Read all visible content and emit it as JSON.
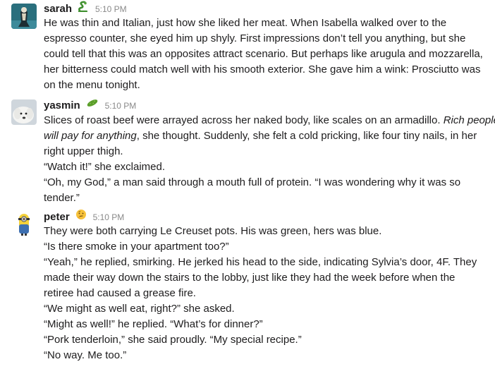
{
  "messages": [
    {
      "sender": "sarah",
      "status_emoji": "snake-emoji-icon",
      "time": "5:10 PM",
      "lines": [
        "He was thin and Italian, just how she liked her meat. When Isabella walked over to the",
        "espresso counter, she eyed him up shyly. First impressions don’t tell you anything, but she",
        "could tell that this was an opposites attract scenario. But perhaps like arugula and mozzarella,",
        "her bitterness could match well with his smooth exterior. She gave him a wink: Prosciutto was",
        "on the menu tonight."
      ]
    },
    {
      "sender": "yasmin",
      "status_emoji": "pickle-emoji-icon",
      "time": "5:10 PM",
      "lines_1": {
        "line1": "Slices of roast beef were arrayed across her naked body, like scales on an armadillo. ",
        "line1_italic": "Rich people",
        "line2_italic": "will pay for anything",
        "line2_rest": ", she thought. Suddenly, she felt a cold pricking, like four tiny nails, in her",
        "line3": "right upper thigh."
      },
      "lines": [
        "“Watch it!” she exclaimed.",
        "“Oh, my God,” a man said through a mouth full of protein. “I was wondering why it was so",
        "tender.”"
      ]
    },
    {
      "sender": "peter",
      "status_emoji": "thinking-face-emoji-icon",
      "time": "5:10 PM",
      "lines": [
        "They were both carrying Le Creuset pots. His was green, hers was blue.",
        "“Is there smoke in your apartment too?”",
        "“Yeah,” he replied, smirking. He jerked his head to the side, indicating Sylvia’s door, 4F. They",
        "made their way down the stairs to the lobby, just like they had the week before when the",
        "retiree had caused a grease fire.",
        "“We might as well eat, right?” she asked.",
        "“Might as well!” he replied. “What’s for dinner?”",
        "“Pork tenderloin,” she said proudly. “My special recipe.”",
        "“No way. Me too.”"
      ]
    }
  ]
}
